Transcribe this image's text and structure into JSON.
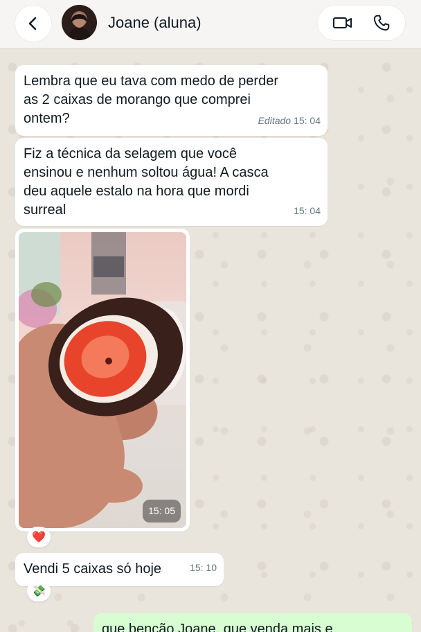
{
  "header": {
    "contact_name": "Joane (aluna)",
    "icons": [
      "chevron-left-icon",
      "video-camera-icon",
      "phone-icon"
    ]
  },
  "messages": [
    {
      "text": "Lembra que eu tava com medo de perder\nas 2 caixas de morango que comprei\nontem?",
      "edited_label": "Editado",
      "time": "15: 04"
    },
    {
      "text": "Fiz a técnica da selagem que você\nensinou e nenhum soltou água! A casca\ndeu aquele estalo na hora que mordi\nsurreal",
      "time": "15: 04"
    },
    {
      "type": "photo",
      "time": "15: 05",
      "reaction": "❤️"
    },
    {
      "text": "Vendi 5 caixas só hoje",
      "time": "15: 10",
      "reaction": "💸"
    },
    {
      "outgoing": true,
      "text": "que benção Joane, que venda mais e"
    }
  ]
}
